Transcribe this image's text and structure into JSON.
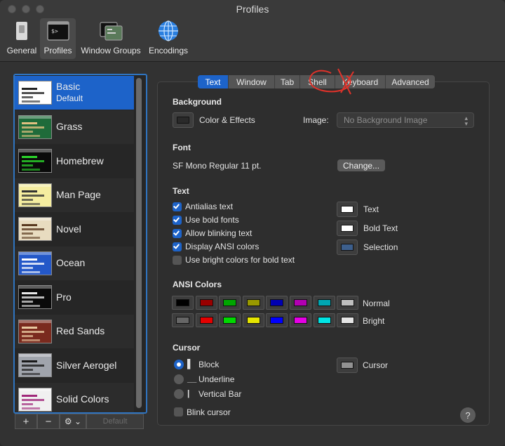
{
  "window": {
    "title": "Profiles"
  },
  "toolbar": {
    "items": [
      {
        "label": "General",
        "icon": "general-switch-icon"
      },
      {
        "label": "Profiles",
        "icon": "terminal-profile-icon",
        "selected": true
      },
      {
        "label": "Window Groups",
        "icon": "window-groups-icon"
      },
      {
        "label": "Encodings",
        "icon": "globe-icon"
      }
    ]
  },
  "profiles": {
    "items": [
      {
        "name": "Basic",
        "subtitle": "Default",
        "bg": "#ffffff",
        "fg": "#222222",
        "selected": true
      },
      {
        "name": "Grass",
        "subtitle": "",
        "bg": "#1f6b3a",
        "fg": "#e0c080"
      },
      {
        "name": "Homebrew",
        "subtitle": "",
        "bg": "#0a0a0a",
        "fg": "#2bd62b"
      },
      {
        "name": "Man Page",
        "subtitle": "",
        "bg": "#f5eda0",
        "fg": "#333333"
      },
      {
        "name": "Novel",
        "subtitle": "",
        "bg": "#e8dcc0",
        "fg": "#5a3a20"
      },
      {
        "name": "Ocean",
        "subtitle": "",
        "bg": "#2458c8",
        "fg": "#ffffff"
      },
      {
        "name": "Pro",
        "subtitle": "",
        "bg": "#0a0a0a",
        "fg": "#e8e8e8"
      },
      {
        "name": "Red Sands",
        "subtitle": "",
        "bg": "#7a2a1e",
        "fg": "#e8c8a0"
      },
      {
        "name": "Silver Aerogel",
        "subtitle": "",
        "bg": "#a0a4ac",
        "fg": "#1a1a1a"
      },
      {
        "name": "Solid Colors",
        "subtitle": "",
        "bg": "#f0f0f0",
        "fg": "#a0287a"
      }
    ],
    "buttons": {
      "add": "+",
      "remove": "−",
      "gear": "⚙ ⌄",
      "default": "Default"
    }
  },
  "tabs": [
    {
      "label": "Text",
      "active": true
    },
    {
      "label": "Window"
    },
    {
      "label": "Tab"
    },
    {
      "label": "Shell"
    },
    {
      "label": "Keyboard"
    },
    {
      "label": "Advanced"
    }
  ],
  "background": {
    "title": "Background",
    "color_effects_label": "Color & Effects",
    "image_label": "Image:",
    "image_value": "No Background Image"
  },
  "font": {
    "title": "Font",
    "value": "SF Mono Regular 11 pt.",
    "change_label": "Change..."
  },
  "text": {
    "title": "Text",
    "options": [
      {
        "label": "Antialias text",
        "checked": true
      },
      {
        "label": "Use bold fonts",
        "checked": true
      },
      {
        "label": "Allow blinking text",
        "checked": true
      },
      {
        "label": "Display ANSI colors",
        "checked": true
      },
      {
        "label": "Use bright colors for bold text",
        "checked": false
      }
    ],
    "color_labels": {
      "text": "Text",
      "bold": "Bold Text",
      "selection": "Selection"
    },
    "colors": {
      "text": "#ffffff",
      "bold": "#ffffff",
      "selection": "#3d5f8c"
    }
  },
  "ansi": {
    "title": "ANSI Colors",
    "normal_label": "Normal",
    "bright_label": "Bright",
    "normal": [
      "#000000",
      "#990000",
      "#00a600",
      "#999900",
      "#0000b2",
      "#b200b2",
      "#00a6b2",
      "#bfbfbf"
    ],
    "bright": [
      "#666666",
      "#e50000",
      "#00d900",
      "#e5e500",
      "#0000ff",
      "#e500e5",
      "#00e5e5",
      "#e5e5e5"
    ]
  },
  "cursor": {
    "title": "Cursor",
    "options": [
      {
        "label": "Block",
        "glyph": "▌",
        "selected": true
      },
      {
        "label": "Underline",
        "glyph": "__"
      },
      {
        "label": "Vertical Bar",
        "glyph": "|"
      }
    ],
    "color_label": "Cursor",
    "color": "#929292",
    "blink_label": "Blink cursor"
  },
  "help": {
    "label": "?"
  },
  "colors": {
    "accent": "#1d63c9",
    "annotation": "#e0322a"
  }
}
